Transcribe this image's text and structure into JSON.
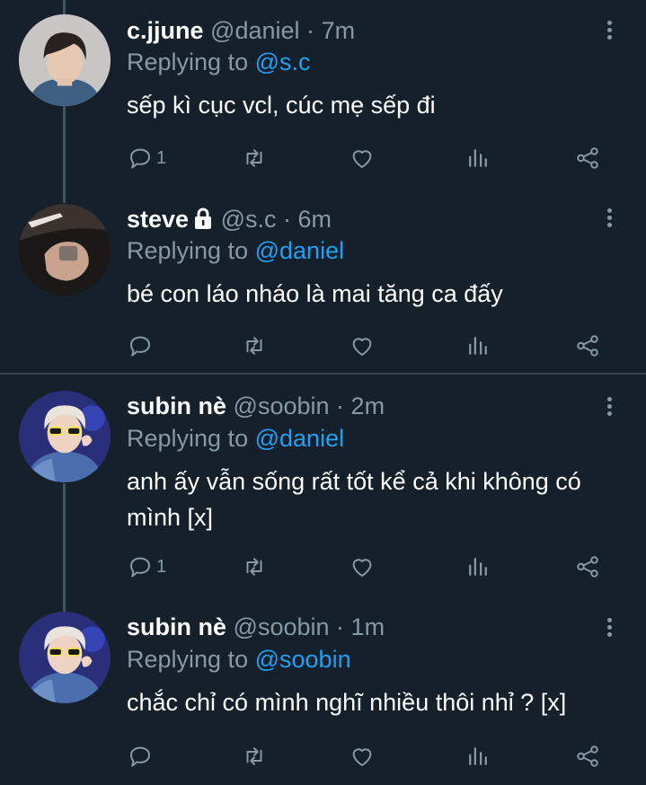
{
  "tweets": [
    {
      "name": "c.jjune",
      "handle": "@daniel",
      "time": "7m",
      "reply_prefix": "Replying to",
      "reply_to": "@s.c",
      "text": "sếp kì cục vcl, cúc mẹ sếp đi",
      "reply_count": "1",
      "avatar_icon": "person-photo-avatar"
    },
    {
      "name": "steve",
      "handle": "@s.c",
      "time": "6m",
      "reply_prefix": "Replying to",
      "reply_to": "@daniel",
      "text": "bé con láo nháo là mai tăng ca đấy",
      "reply_count": "",
      "locked": true,
      "avatar_icon": "hand-photo-avatar"
    },
    {
      "name": "subin nè",
      "handle": "@soobin",
      "time": "2m",
      "reply_prefix": "Replying to",
      "reply_to": "@daniel",
      "text": "anh ấy vẫn sống rất tốt kể cả khi không có mình  [x]",
      "reply_count": "1",
      "avatar_icon": "person-sunglasses-avatar"
    },
    {
      "name": "subin nè",
      "handle": "@soobin",
      "time": "1m",
      "reply_prefix": "Replying to",
      "reply_to": "@soobin",
      "text": "chắc chỉ có mình nghĩ nhiều thôi nhỉ ? [x]",
      "reply_count": "",
      "avatar_icon": "person-sunglasses-avatar"
    }
  ],
  "separator": "·",
  "colors": {
    "background": "#15202b",
    "secondary_text": "#8899a6",
    "mention": "#1da1f2",
    "thread_line": "#3d5466",
    "divider": "#38444d"
  }
}
